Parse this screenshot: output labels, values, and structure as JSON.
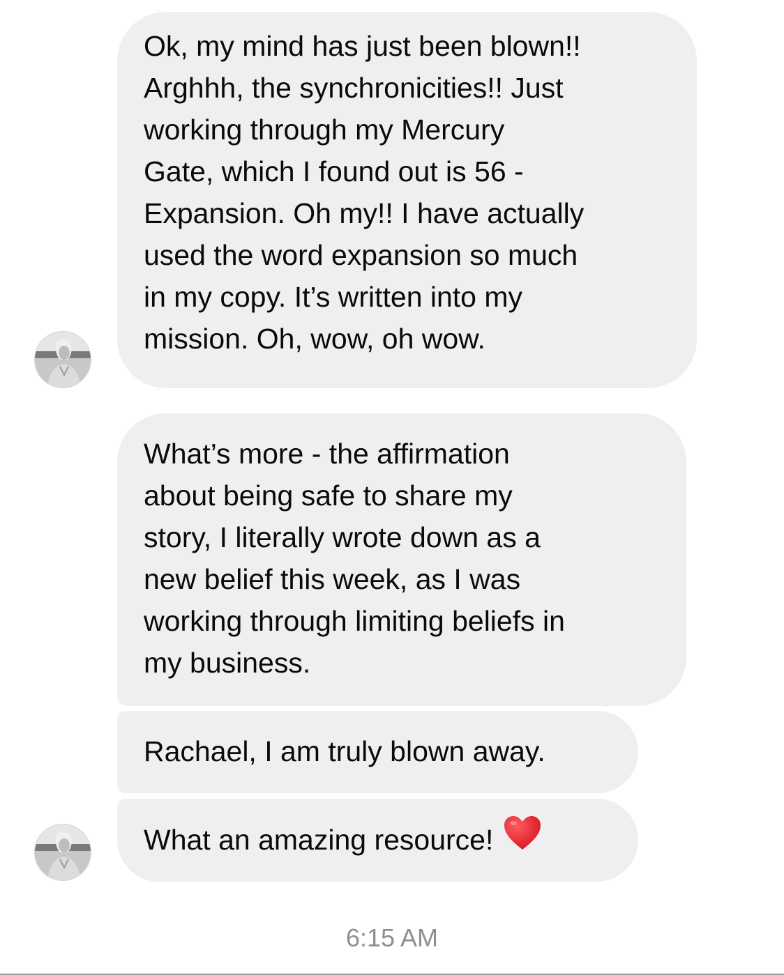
{
  "messages": [
    {
      "lines": [
        "Ok, my mind has just been blown!!",
        "Arghhh, the synchronicities!! Just",
        "working through my Mercury",
        "Gate, which I found out is 56 -",
        "Expansion. Oh my!! I have actually",
        "used the word expansion so much",
        "in my copy. It’s written into my",
        "mission. Oh, wow, oh wow."
      ]
    },
    {
      "lines": [
        "What’s more - the affirmation",
        "about being safe to share my",
        "story, I literally wrote down as a",
        "new belief this week, as I was",
        "working through limiting beliefs in",
        "my business."
      ]
    },
    {
      "lines": [
        "Rachael, I am truly blown away."
      ]
    },
    {
      "lines": [
        "What an amazing resource!"
      ],
      "emoji": "heart-emoji"
    }
  ],
  "timestamp": "6:15 AM",
  "colors": {
    "bubble_bg": "#efeff0",
    "text": "#0a0a0a",
    "timestamp": "#8e8e93",
    "heart": "#e0192c"
  }
}
